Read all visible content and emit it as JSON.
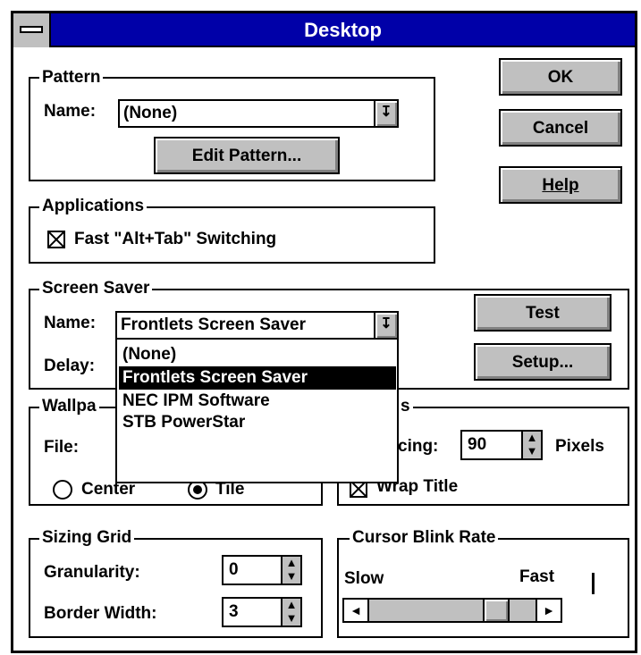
{
  "window": {
    "title": "Desktop"
  },
  "buttons": {
    "ok": "OK",
    "cancel": "Cancel",
    "help": "Help",
    "test": "Test",
    "setup": "Setup...",
    "edit_pattern": "Edit Pattern..."
  },
  "pattern": {
    "group_label": "Pattern",
    "name_label": "Name:",
    "name_value": "(None)"
  },
  "applications": {
    "group_label": "Applications",
    "fast_switch_label": "Fast \"Alt+Tab\" Switching",
    "fast_switch_checked": true
  },
  "screen_saver": {
    "group_label": "Screen Saver",
    "name_label": "Name:",
    "name_value": "Frontlets Screen Saver",
    "delay_label": "Delay:",
    "options": [
      "(None)",
      "Frontlets Screen Saver",
      "NEC IPM Software",
      "STB PowerStar"
    ],
    "selected_index": 1
  },
  "wallpaper": {
    "group_label_visible": "Wallpa",
    "file_label": "File:",
    "center_label": "Center",
    "tile_label": "Tile",
    "selected": "Tile"
  },
  "icons": {
    "group_label_visible": "s",
    "spacing_label_visible": "cing:",
    "spacing_value": "90",
    "pixels_label": "Pixels",
    "wrap_title_label": "Wrap Title",
    "wrap_title_checked": true
  },
  "sizing_grid": {
    "group_label": "Sizing Grid",
    "granularity_label": "Granularity:",
    "granularity_value": "0",
    "border_width_label": "Border Width:",
    "border_width_value": "3"
  },
  "cursor_blink": {
    "group_label": "Cursor Blink Rate",
    "slow_label": "Slow",
    "fast_label": "Fast",
    "rate_fraction": 0.82
  }
}
